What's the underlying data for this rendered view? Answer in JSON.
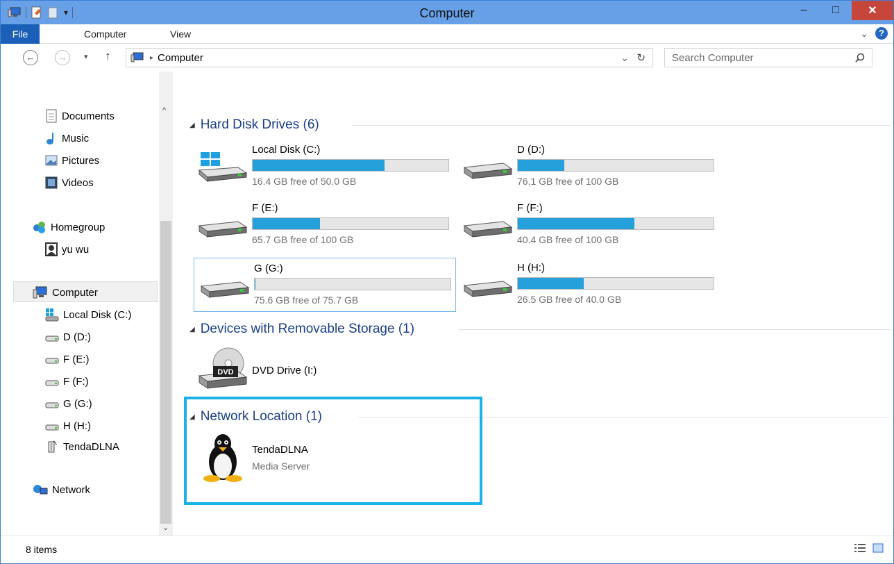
{
  "window": {
    "title": "Computer",
    "minimize": "–",
    "maximize": "□",
    "close": "✕"
  },
  "ribbon": {
    "tabs": [
      "File",
      "Computer",
      "View"
    ]
  },
  "address": {
    "path": "Computer",
    "search_placeholder": "Search Computer"
  },
  "nav": {
    "items": [
      "Documents",
      "Music",
      "Pictures",
      "Videos",
      "Homegroup",
      "yu wu",
      "Computer",
      "Local Disk (C:)",
      "D (D:)",
      "F (E:)",
      "F (F:)",
      "G (G:)",
      "H (H:)",
      "TendaDLNA",
      "Network"
    ]
  },
  "groups": {
    "hdd": "Hard Disk Drives (6)",
    "removable": "Devices with Removable Storage (1)",
    "network": "Network Location (1)"
  },
  "drives": [
    {
      "name": "Local Disk (C:)",
      "free": "16.4 GB free of 50.0 GB",
      "used_fraction": 0.672
    },
    {
      "name": "D (D:)",
      "free": "76.1 GB free of 100 GB",
      "used_fraction": 0.239
    },
    {
      "name": "F (E:)",
      "free": "65.7 GB free of 100 GB",
      "used_fraction": 0.343
    },
    {
      "name": "F (F:)",
      "free": "40.4 GB free of 100 GB",
      "used_fraction": 0.596
    },
    {
      "name": "G (G:)",
      "free": "75.6 GB free of 75.7 GB",
      "used_fraction": 0.001
    },
    {
      "name": "H (H:)",
      "free": "26.5 GB free of 40.0 GB",
      "used_fraction": 0.338
    }
  ],
  "dvd": {
    "name": "DVD Drive (I:)",
    "badge": "DVD"
  },
  "network_item": {
    "name": "TendaDLNA",
    "type": "Media Server"
  },
  "status": {
    "items": "8 items"
  },
  "colors": {
    "accent": "#26a0da",
    "title_bar": "#67a0e6",
    "highlight": "#1bb2ea"
  }
}
